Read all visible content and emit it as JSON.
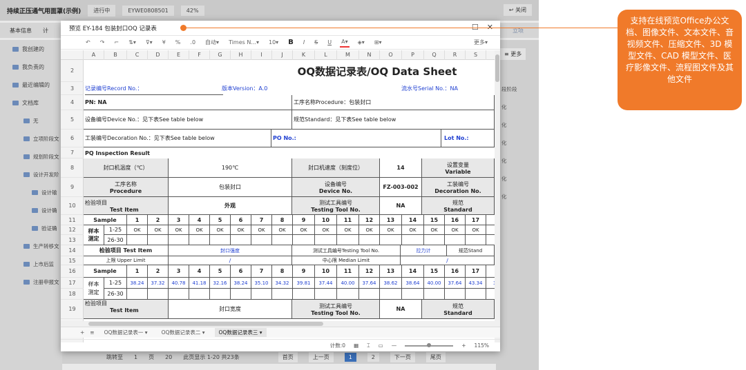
{
  "bg": {
    "title": "持续正压通气用面罩(示例)",
    "status": "进行中",
    "code": "EYWE0808501",
    "percent": "42%",
    "close": "关闭",
    "tabs": [
      "基本信息",
      "计"
    ],
    "tab_right": "立项",
    "more": "更多",
    "sidebar": [
      "我创建的",
      "我负责的",
      "最近编辑的",
      "文档库",
      "无",
      "立项阶段文",
      "规划阶段文",
      "设计开发阶",
      "设计输",
      "设计确",
      "验证确",
      "生产转移文",
      "上市后监",
      "注册申报文"
    ],
    "right_items": [
      "段",
      "段",
      "段阶段",
      "化",
      "化",
      "化",
      "化",
      "化",
      "化",
      "化",
      "化"
    ],
    "bottom": {
      "goto": "跳转至",
      "page": "1",
      "page_unit": "页",
      "per": "20",
      "info": "此页显示 1-20 共23条",
      "home": "首页",
      "prev": "上一页",
      "p1": "1",
      "p2": "2",
      "next": "下一页",
      "last": "尾页"
    }
  },
  "modal": {
    "title": "预览 EY-184 包装封口OQ 记录表",
    "toolbar": {
      "auto": "自动",
      "font": "Times N...",
      "size": "10",
      "bold": "B",
      "italic": "I",
      "strike": "S",
      "underline": "U",
      "color": "A",
      "more": "更多"
    },
    "columns": [
      "A",
      "B",
      "C",
      "D",
      "E",
      "F",
      "G",
      "H",
      "I",
      "J",
      "K",
      "L",
      "M",
      "N",
      "O",
      "P",
      "Q",
      "R",
      "S"
    ],
    "rows": [
      "2",
      "3",
      "4",
      "5",
      "6",
      "7",
      "8",
      "9",
      "10",
      "11",
      "12",
      "13",
      "14",
      "15",
      "16",
      "17",
      "18",
      "19"
    ],
    "sheet": {
      "title": "OQ数据记录表/OQ Data Sheet",
      "record_no": "记录编号Record No.：",
      "version": "版本Version：A.0",
      "serial": "流水号Serial No.：NA",
      "pn": "PN: NA",
      "procedure": "工序名称Procedure：包装封口",
      "device": "设备编号Device No.：见下表See table below",
      "standard": "规范Standard：见下表See table below",
      "decoration": "工装编号Decoration No.：见下表See table below",
      "po": "PO No.:",
      "lot": "Lot No.:",
      "pq": "PQ Inspection Result",
      "r8": [
        "封口机温度（℃）",
        "190℃",
        "封口机速度（刻度位）",
        "14",
        "设置变量",
        "Variable"
      ],
      "r9": [
        "工序名称",
        "Procedure",
        "包装封口",
        "设备编号",
        "Device No.",
        "FZ-003-002",
        "工装编号",
        "Decoration No."
      ],
      "r10": [
        "检验项目",
        "Test Item",
        "外观",
        "测试工具编号",
        "Testing Tool No.",
        "NA",
        "规范",
        "Standard"
      ],
      "sample": "Sample",
      "nums": [
        "1",
        "2",
        "3",
        "4",
        "5",
        "6",
        "7",
        "8",
        "9",
        "10",
        "11",
        "12",
        "13",
        "14",
        "15",
        "16",
        "17",
        "1"
      ],
      "sample_cn": "样本",
      "measure_cn": "测定",
      "r12_label": "1-25",
      "r12_vals": [
        "OK",
        "OK",
        "OK",
        "OK",
        "OK",
        "OK",
        "OK",
        "OK",
        "OK",
        "OK",
        "OK",
        "OK",
        "OK",
        "OK",
        "OK",
        "OK",
        "OK"
      ],
      "r13_label": "26-30",
      "r14": [
        "检验项目 Test Item",
        "封口强度",
        "测试工具编号Testing Tool No.",
        "拉力计",
        "规范Stand"
      ],
      "r15": [
        "上限 Upper Limit",
        "/",
        "中心限 Median Limit",
        "/"
      ],
      "r17_vals": [
        "38.24",
        "37.32",
        "40.78",
        "41.18",
        "32.16",
        "38.24",
        "35.10",
        "34.32",
        "39.81",
        "37.44",
        "40.00",
        "37.64",
        "38.62",
        "38.64",
        "40.00",
        "37.64",
        "43.34",
        "35"
      ],
      "r19": [
        "检验项目",
        "Test Item",
        "封口宽度",
        "测试工具编号",
        "Testing Tool No.",
        "NA",
        "规范",
        "Standard"
      ]
    },
    "sheet_tabs": [
      "OQ数据记录表一",
      "OQ数据记录表二",
      "OQ数据记录表三"
    ],
    "status": {
      "count": "计数:0",
      "zoom": "115%"
    }
  },
  "callout": {
    "text": "支持在线预览Office办公文档、图像文件、文本文件、音视频文件、压缩文件、3D 模型文件、CAD 模型文件、医疗影像文件、流程图文件及其他文件"
  },
  "colors": {
    "accent": "#f07a2a",
    "blue_text": "#1f3fd1"
  }
}
